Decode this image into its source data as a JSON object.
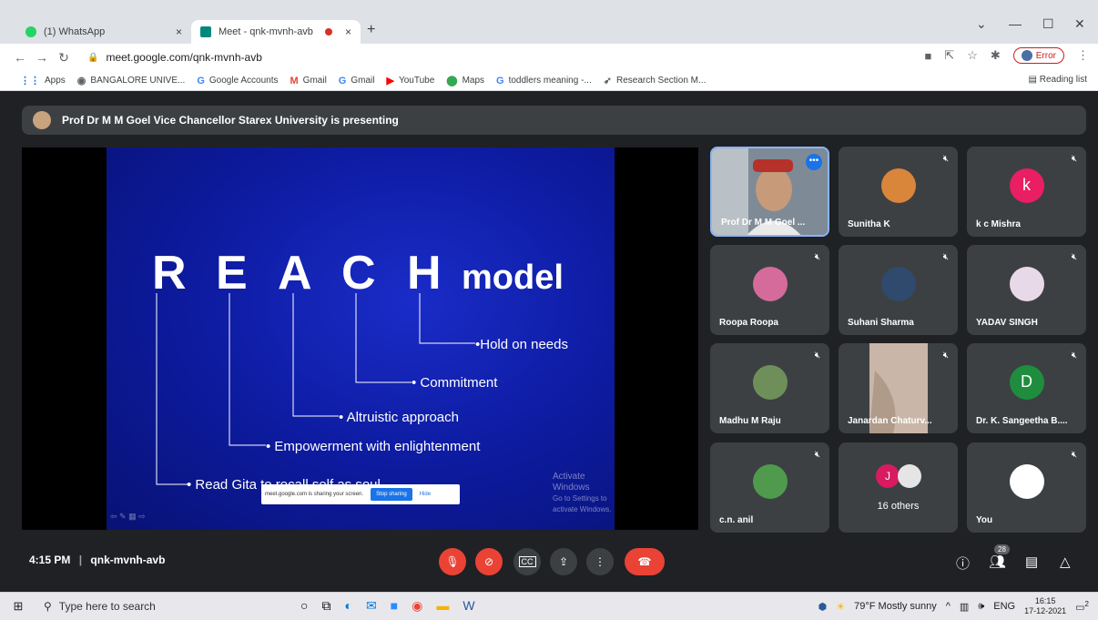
{
  "browser": {
    "tabs": [
      {
        "title": "(1) WhatsApp",
        "close": "×",
        "active": false
      },
      {
        "title": "Meet - qnk-mvnh-avb",
        "close": "×",
        "active": true
      }
    ],
    "new_tab": "+",
    "url": "meet.google.com/qnk-mvnh-avb",
    "error_label": "Error",
    "bookmarks": [
      {
        "icon": "apps-icon",
        "glyph": "⋮⋮",
        "label": "Apps"
      },
      {
        "icon": "globe-icon",
        "glyph": "◉",
        "label": "BANGALORE UNIVE..."
      },
      {
        "icon": "google-icon",
        "glyph": "G",
        "label": "Google Accounts"
      },
      {
        "icon": "gmail-icon",
        "glyph": "M",
        "label": "Gmail"
      },
      {
        "icon": "google-icon",
        "glyph": "G",
        "label": "Gmail"
      },
      {
        "icon": "youtube-icon",
        "glyph": "▶",
        "label": "YouTube"
      },
      {
        "icon": "maps-icon",
        "glyph": "⬤",
        "label": "Maps"
      },
      {
        "icon": "google-icon",
        "glyph": "G",
        "label": "toddlers meaning -..."
      },
      {
        "icon": "research-icon",
        "glyph": "➶",
        "label": "Research Section M..."
      }
    ],
    "reading_list": "Reading list"
  },
  "meet": {
    "presenting_text": "Prof Dr M M Goel Vice Chancellor Starex University is presenting",
    "slide": {
      "letters": [
        "R",
        "E",
        "A",
        "C",
        "H"
      ],
      "model_word": "model",
      "items": [
        "•Hold on needs",
        "• Commitment",
        "• Altruistic approach",
        "• Empowerment with enlightenment",
        "• Read Gita to recall self as soul"
      ],
      "watermark_title": "Activate Windows",
      "watermark_sub": "Go to Settings to activate Windows.",
      "share_text": "meet.google.com is sharing your screen.",
      "stop_sharing": "Stop sharing",
      "hide": "Hide"
    },
    "tiles": [
      {
        "name": "Prof Dr M M Goel ...",
        "kind": "video"
      },
      {
        "name": "Sunitha K",
        "kind": "photo"
      },
      {
        "name": "k c Mishra",
        "kind": "letter",
        "letter": "k",
        "color": "#e91e63"
      },
      {
        "name": "Roopa Roopa",
        "kind": "photo"
      },
      {
        "name": "Suhani Sharma",
        "kind": "photo"
      },
      {
        "name": "YADAV SINGH",
        "kind": "photo"
      },
      {
        "name": "Madhu M Raju",
        "kind": "photo"
      },
      {
        "name": "Janardan Chaturv...",
        "kind": "video"
      },
      {
        "name": "Dr. K. Sangeetha B....",
        "kind": "letter",
        "letter": "D",
        "color": "#1e8e3e"
      },
      {
        "name": "c.n. anil",
        "kind": "photo"
      },
      {
        "name": "16 others",
        "kind": "others",
        "letter": "J"
      },
      {
        "name": "You",
        "kind": "photo"
      }
    ],
    "time": "4:15 PM",
    "separator": "|",
    "meeting_code": "qnk-mvnh-avb",
    "cc_label": "CC",
    "participants_count": "28"
  },
  "taskbar": {
    "search_placeholder": "Type here to search",
    "weather": "79°F Mostly sunny",
    "lang": "ENG",
    "time": "16:15",
    "date": "17-12-2021",
    "notifications": "2"
  }
}
